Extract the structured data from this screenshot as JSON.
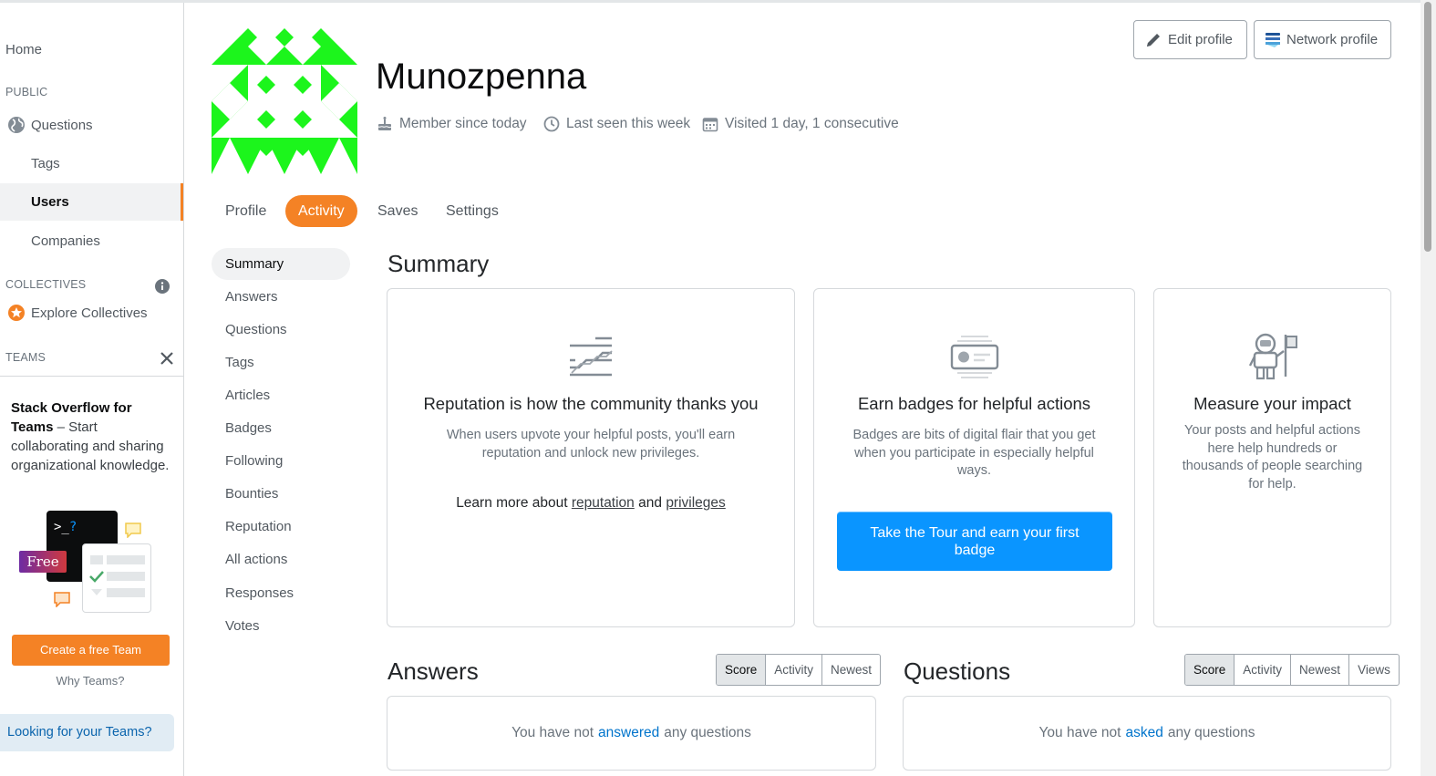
{
  "nav": {
    "home": "Home",
    "public_label": "PUBLIC",
    "questions": "Questions",
    "tags": "Tags",
    "users": "Users",
    "companies": "Companies",
    "collectives_label": "COLLECTIVES",
    "explore_collectives": "Explore Collectives",
    "teams_label": "TEAMS",
    "teams_promo_bold": "Stack Overflow for Teams",
    "teams_promo_rest": " – Start collaborating and sharing organizational knowledge.",
    "free_badge": "Free",
    "terminal_text": ">_?",
    "create_team": "Create a free Team",
    "why_teams": "Why Teams?",
    "looking_for_teams": "Looking for your Teams?"
  },
  "profile": {
    "username": "Munozpenna",
    "member_since": "Member since today",
    "last_seen": "Last seen this week",
    "visited": "Visited 1 day, 1 consecutive",
    "edit_profile": "Edit profile",
    "network_profile": "Network profile"
  },
  "tabs": [
    "Profile",
    "Activity",
    "Saves",
    "Settings"
  ],
  "subnav": [
    "Summary",
    "Answers",
    "Questions",
    "Tags",
    "Articles",
    "Badges",
    "Following",
    "Bounties",
    "Reputation",
    "All actions",
    "Responses",
    "Votes"
  ],
  "summary": {
    "heading": "Summary",
    "reputation": {
      "title": "Reputation is how the community thanks you",
      "text": "When users upvote your helpful posts, you'll earn reputation and unlock new privileges.",
      "learn_prefix": "Learn more about",
      "reputation_link": "reputation",
      "and": "and",
      "privileges_link": "privileges"
    },
    "badges": {
      "title": "Earn badges for helpful actions",
      "text": "Badges are bits of digital flair that you get when you participate in especially helpful ways.",
      "button": "Take the Tour and earn your first badge"
    },
    "impact": {
      "title": "Measure your impact",
      "text": "Your posts and helpful actions here help hundreds or thousands of people searching for help."
    }
  },
  "answers": {
    "heading": "Answers",
    "sort": [
      "Score",
      "Activity",
      "Newest"
    ],
    "empty_prefix": "You have not",
    "empty_link": "answered",
    "empty_suffix": "any questions"
  },
  "questions": {
    "heading": "Questions",
    "sort": [
      "Score",
      "Activity",
      "Newest",
      "Views"
    ],
    "empty_prefix": "You have not",
    "empty_link": "asked",
    "empty_suffix": "any questions"
  },
  "colors": {
    "accent_orange": "#f48225",
    "button_blue": "#0a95ff",
    "avatar_green": "#1cf51c"
  }
}
